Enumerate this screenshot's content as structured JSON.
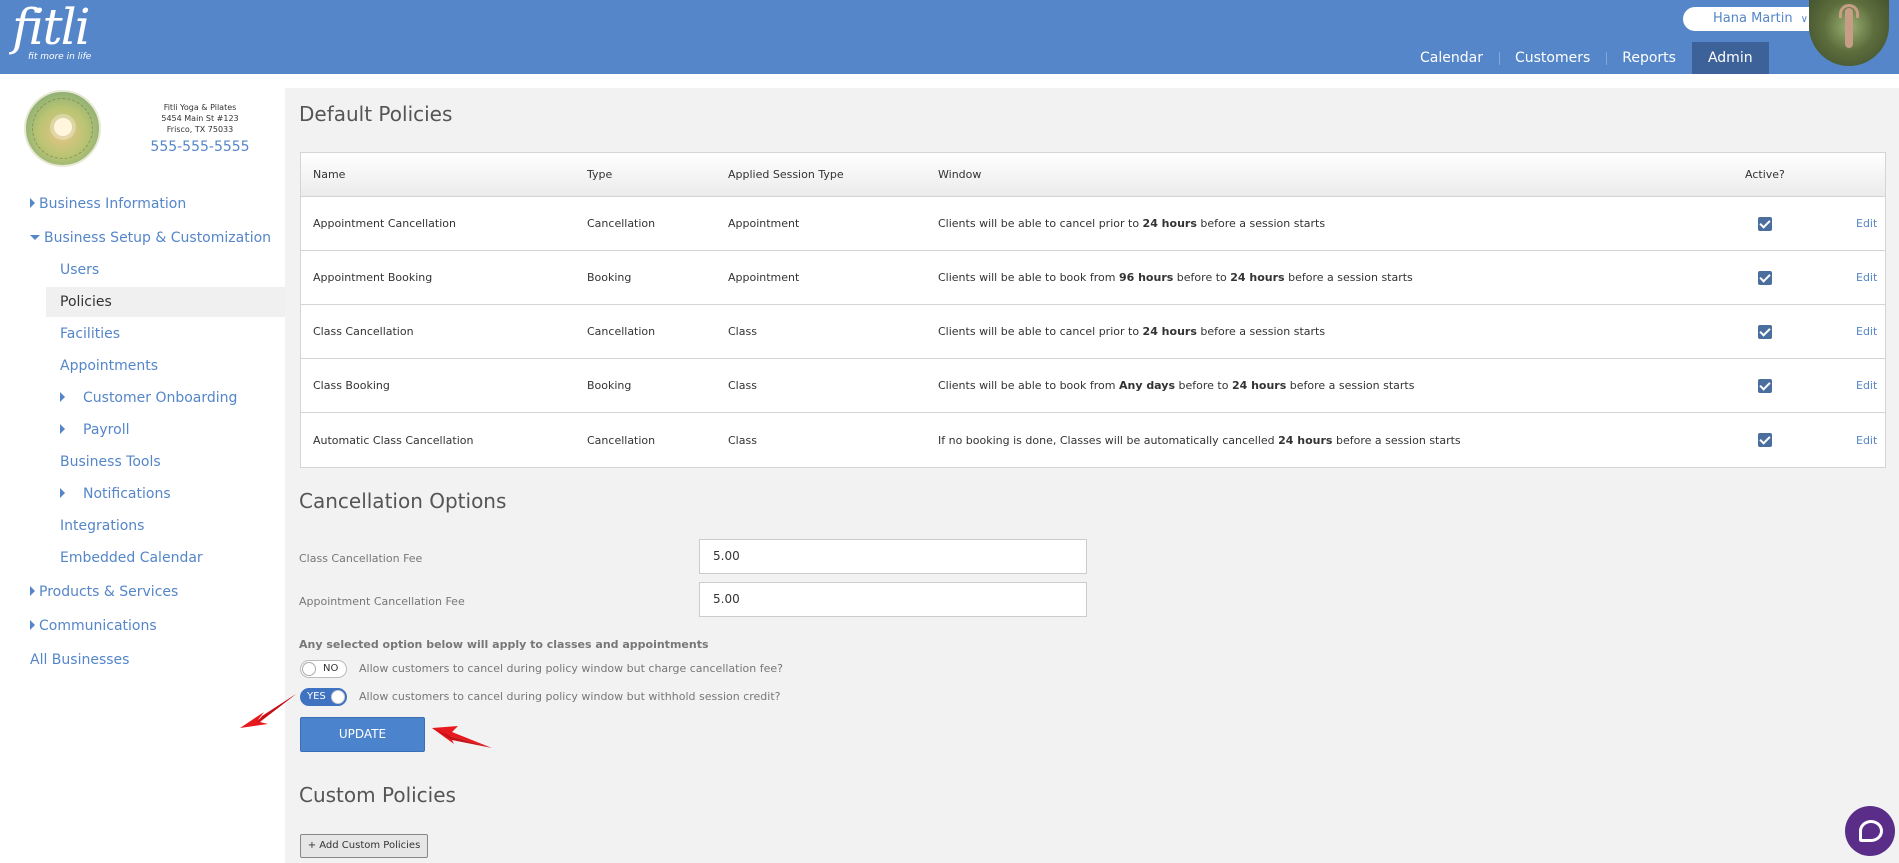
{
  "header": {
    "logo_text": "fitli",
    "logo_tagline": "fit more in life",
    "user_name": "Hana Martin",
    "nav": [
      {
        "label": "Calendar"
      },
      {
        "label": "Customers"
      },
      {
        "label": "Reports"
      },
      {
        "label": "Admin"
      }
    ]
  },
  "sidebar": {
    "business": {
      "name": "Fitli Yoga & Pilates",
      "address1": "5454 Main St #123",
      "address2": "Frisco, TX 75033",
      "phone": "555-555-5555"
    },
    "menu": {
      "business_information": "Business Information",
      "business_setup": "Business Setup & Customization",
      "users": "Users",
      "policies": "Policies",
      "facilities": "Facilities",
      "appointments": "Appointments",
      "customer_onboarding": "Customer Onboarding",
      "payroll": "Payroll",
      "business_tools": "Business Tools",
      "notifications": "Notifications",
      "integrations": "Integrations",
      "embedded_calendar": "Embedded Calendar",
      "products_services": "Products & Services",
      "communications": "Communications",
      "all_businesses": "All Businesses"
    }
  },
  "default_policies": {
    "title": "Default Policies",
    "columns": {
      "name": "Name",
      "type": "Type",
      "applied": "Applied Session Type",
      "window": "Window",
      "active": "Active?"
    },
    "rows": [
      {
        "name": "Appointment Cancellation",
        "type": "Cancellation",
        "applied": "Appointment",
        "w1": "Clients will be able to cancel prior to ",
        "w2": "24 hours",
        "w3": " before a session starts",
        "w4": "",
        "w5": "",
        "active": true,
        "edit": "Edit"
      },
      {
        "name": "Appointment Booking",
        "type": "Booking",
        "applied": "Appointment",
        "w1": "Clients will be able to book from ",
        "w2": "96 hours",
        "w3": " before to ",
        "w4": "24 hours",
        "w5": " before a session starts",
        "active": true,
        "edit": "Edit"
      },
      {
        "name": "Class Cancellation",
        "type": "Cancellation",
        "applied": "Class",
        "w1": "Clients will be able to cancel prior to ",
        "w2": "24 hours",
        "w3": " before a session starts",
        "w4": "",
        "w5": "",
        "active": true,
        "edit": "Edit"
      },
      {
        "name": "Class Booking",
        "type": "Booking",
        "applied": "Class",
        "w1": "Clients will be able to book from ",
        "w2": "Any days",
        "w3": " before to ",
        "w4": "24 hours",
        "w5": " before a session starts",
        "active": true,
        "edit": "Edit"
      },
      {
        "name": "Automatic Class Cancellation",
        "type": "Cancellation",
        "applied": "Class",
        "w1": "If no booking is done, Classes will be automatically cancelled ",
        "w2": "24 hours",
        "w3": " before a session starts",
        "w4": "",
        "w5": "",
        "active": true,
        "edit": "Edit"
      }
    ]
  },
  "cancellation_options": {
    "title": "Cancellation Options",
    "class_fee_label": "Class Cancellation Fee",
    "class_fee_value": "5.00",
    "appt_fee_label": "Appointment Cancellation Fee",
    "appt_fee_value": "5.00",
    "note": "Any selected option below will apply to classes and appointments",
    "toggle1": {
      "state": "NO",
      "label": "Allow customers to cancel during policy window but charge cancellation fee?"
    },
    "toggle2": {
      "state": "YES",
      "label": "Allow customers to cancel during policy window but withhold session credit?"
    },
    "update_label": "UPDATE"
  },
  "custom_policies": {
    "title": "Custom Policies",
    "add_label": "+ Add Custom Policies"
  },
  "colors": {
    "header": "#5486c9",
    "accent": "#4b83cc",
    "arrow": "#e8191e"
  }
}
